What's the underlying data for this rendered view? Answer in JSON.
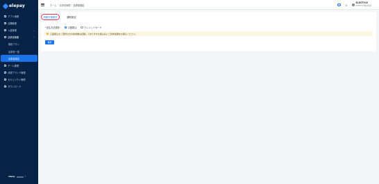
{
  "app": {
    "logo_text": "elepay"
  },
  "sidebar": {
    "items": [
      {
        "label": "アプリ管理",
        "icon": "app-icon"
      },
      {
        "label": "店舗管理",
        "icon": "store-icon"
      },
      {
        "label": "入金管理",
        "icon": "deposit-icon",
        "caret": "⌄"
      },
      {
        "label": "請求書管理",
        "icon": "invoice-icon",
        "caret": "⌃"
      },
      {
        "label": "取扱プラン"
      },
      {
        "label": "請求書一覧"
      },
      {
        "label": "請求書設定"
      },
      {
        "label": "チーム管理",
        "icon": "team-icon"
      },
      {
        "label": "決済ブランド管理",
        "icon": "brand-icon"
      },
      {
        "label": "セキュリティ管理",
        "icon": "security-icon"
      },
      {
        "label": "ダウンロード",
        "icon": "download-icon"
      }
    ],
    "footer": {
      "brand": "elepay",
      "version": "",
      "help": "?"
    }
  },
  "header": {
    "breadcrumb": [
      "ホーム",
      "請求書管理",
      "請求書設定"
    ],
    "user_name": "ELESTYLE",
    "user_sub": "ELESTYLE株式会社",
    "download_glyph": "⤓",
    "help_glyph": "?"
  },
  "main": {
    "tabs": [
      {
        "label": "自動引落設定"
      },
      {
        "label": "通知設定"
      }
    ],
    "form": {
      "required_mark": "*",
      "label": "支払方法選択：",
      "options": [
        {
          "label": "口座振込",
          "checked": true
        },
        {
          "label": "クレジットカード",
          "checked": false
        }
      ]
    },
    "alert": {
      "icon": "!",
      "text": "口座振込をご選択の方の請求書は記載してありますお振込先にご請求金額をお振込ください。"
    },
    "save_label": "保存"
  },
  "colors": {
    "sidebar_bg": "#062347",
    "accent": "#1a73e8",
    "active_tab_border": "#e8344a",
    "alert_bg": "#fdf6e3",
    "alert_icon": "#f0a020"
  }
}
